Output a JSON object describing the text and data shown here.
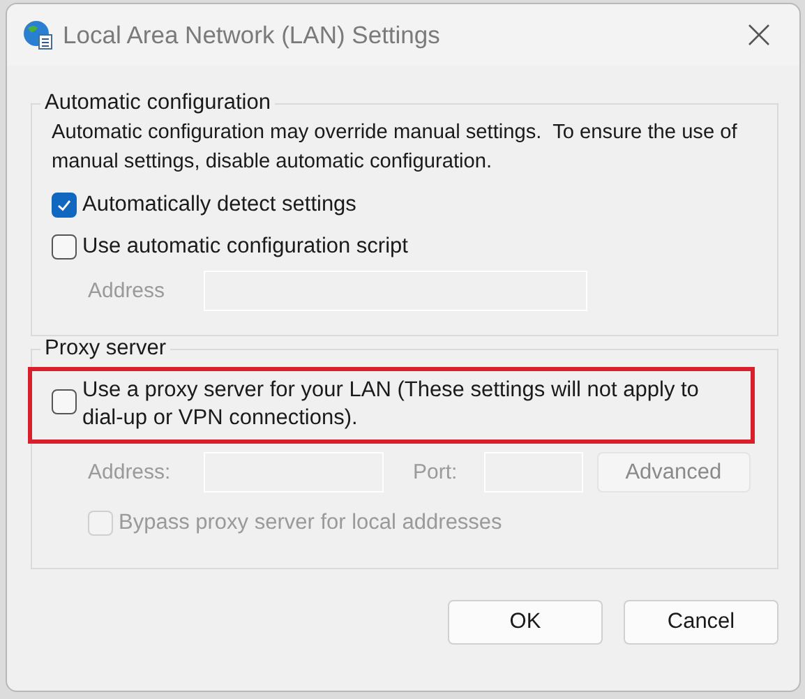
{
  "window": {
    "title": "Local Area Network (LAN) Settings"
  },
  "automatic_configuration": {
    "title": "Automatic configuration",
    "description": "Automatic configuration may override manual settings.  To ensure the use of manual settings, disable automatic configuration.",
    "options": [
      {
        "label": "Automatically detect settings",
        "checked": true,
        "disabled": false
      },
      {
        "label": "Use automatic configuration script",
        "checked": false,
        "disabled": false
      }
    ],
    "address": {
      "label": "Address",
      "disabled": true
    }
  },
  "proxy_server": {
    "title": "Proxy server",
    "option": {
      "label": "Use a proxy server for your LAN (These settings will not apply to dial-up or VPN connections).",
      "checked": false,
      "highlighted": true
    },
    "address": {
      "label": "Address:",
      "disabled": true
    },
    "port": {
      "label": "Port:",
      "disabled": true
    },
    "advanced_button": {
      "label": "Advanced",
      "disabled": true
    },
    "bypass": {
      "label": "Bypass proxy server for local addresses",
      "checked": false,
      "disabled": true
    }
  },
  "buttons": [
    {
      "label": "OK"
    },
    {
      "label": "Cancel"
    }
  ]
}
